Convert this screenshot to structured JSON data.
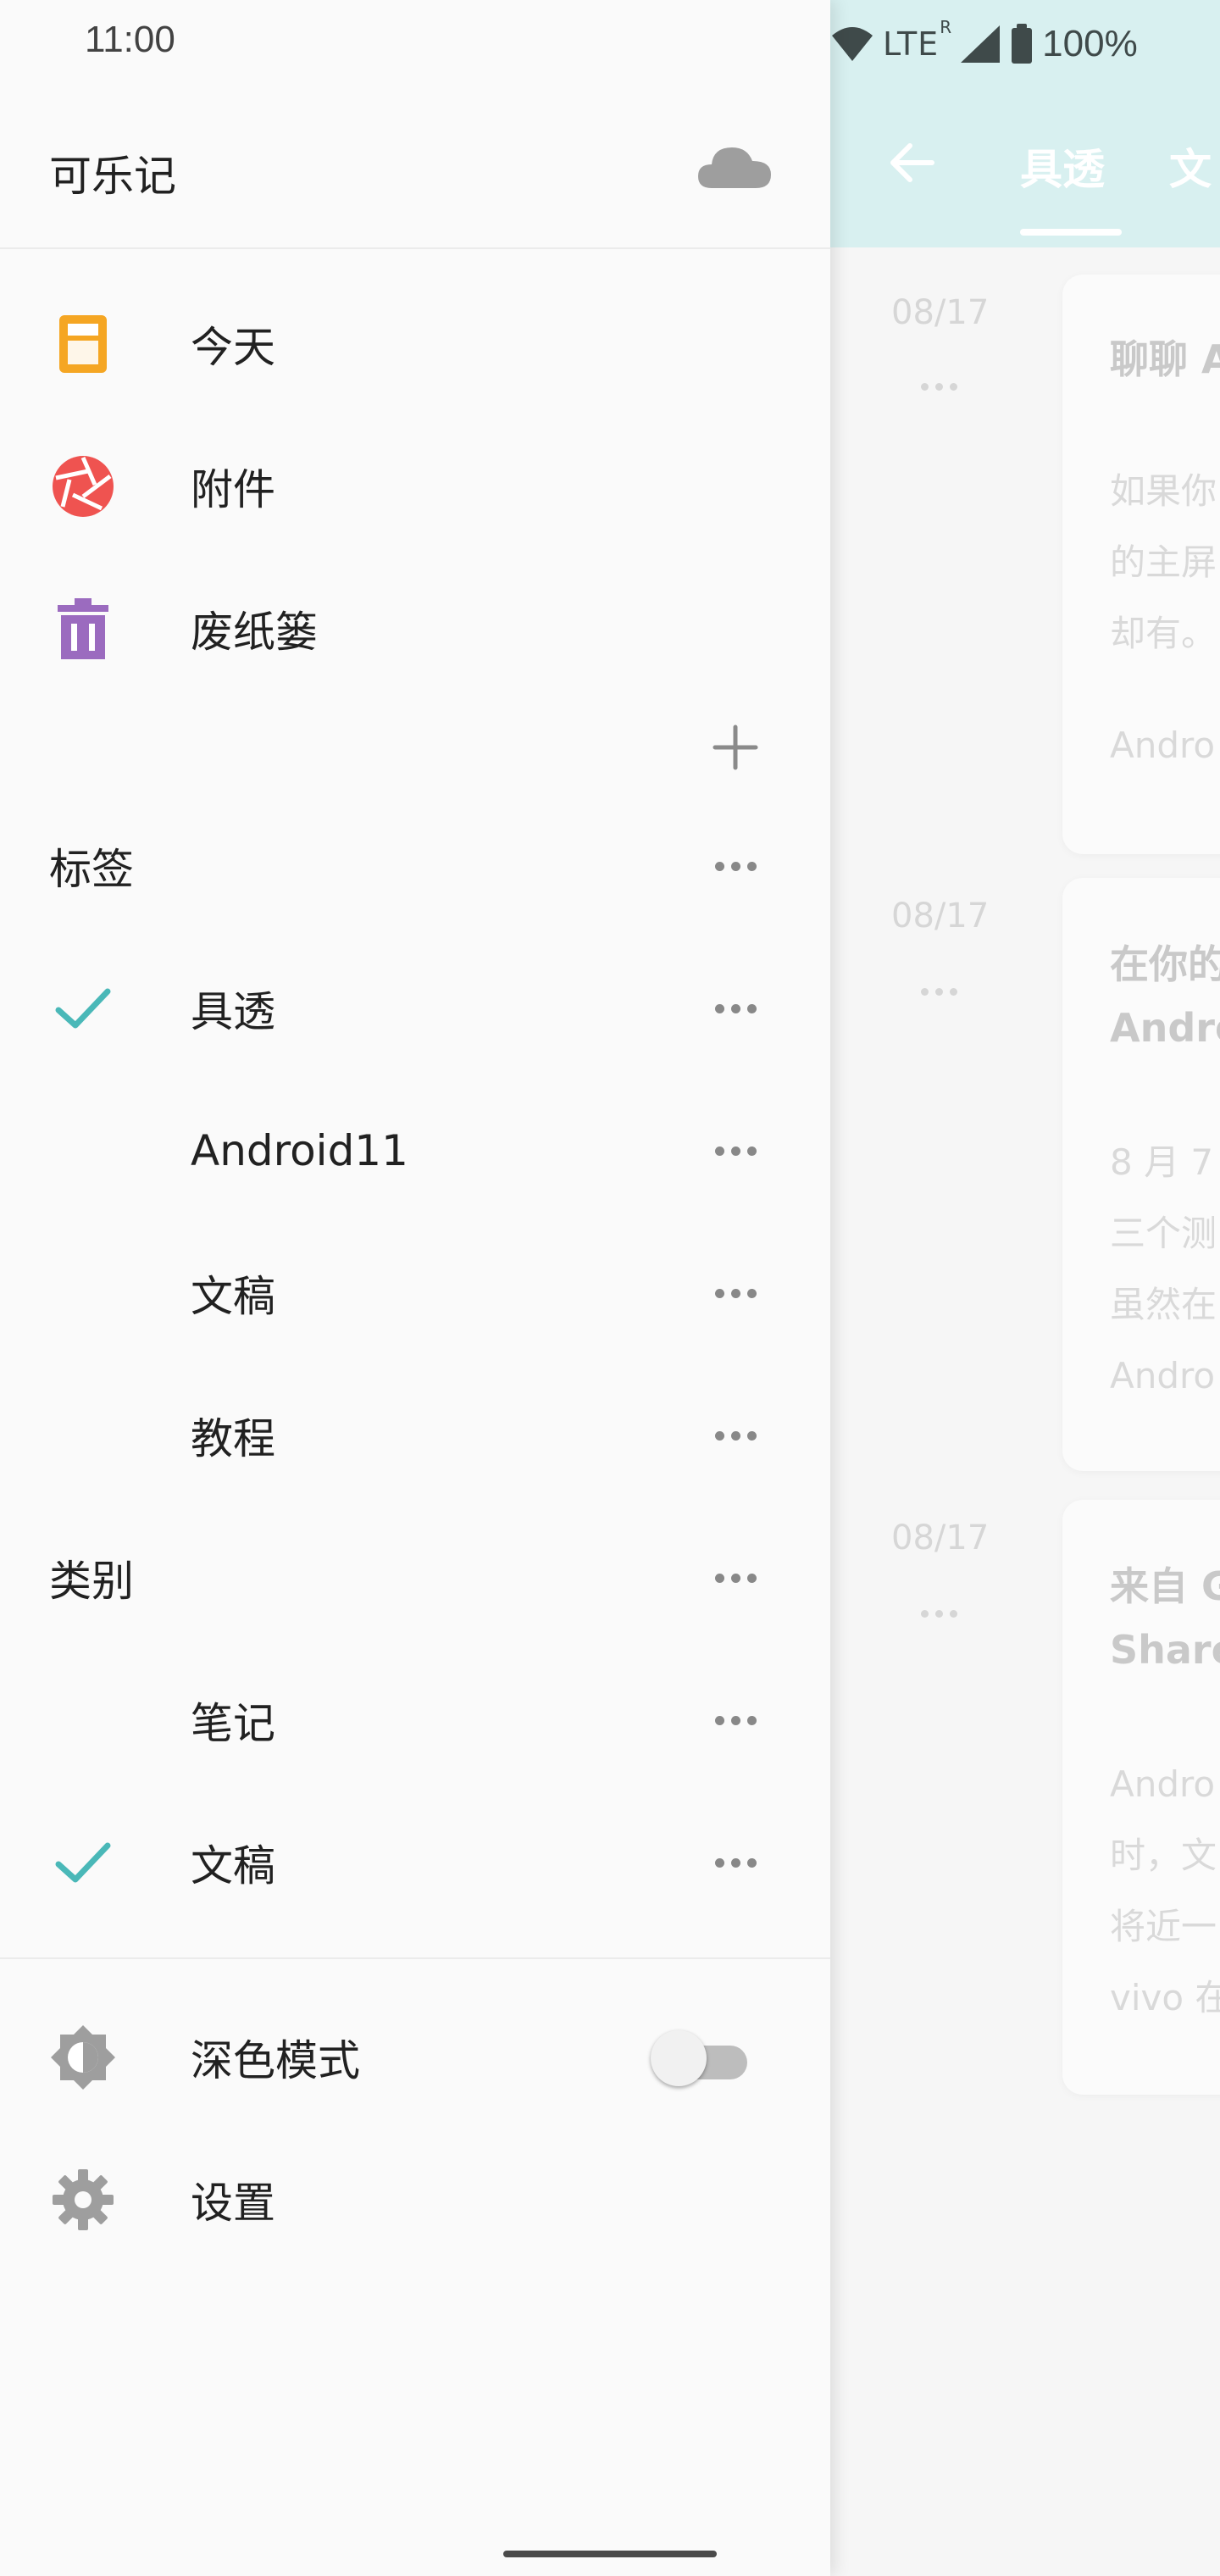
{
  "status_bar": {
    "time": "11:00",
    "network": "LTE",
    "roaming": "R",
    "battery": "100%"
  },
  "background": {
    "tabs": [
      "具透",
      "文"
    ],
    "entries": [
      {
        "date": "08/17",
        "title_lines": [
          "聊聊 A"
        ],
        "body_lines": [
          "如果你",
          "的主屏",
          "却有。"
        ],
        "tag": "Andro"
      },
      {
        "date": "08/17",
        "title_lines": [
          "在你的",
          "Andro"
        ],
        "body_lines": [
          "8 月 7",
          "三个测",
          "虽然在"
        ],
        "tag": "Andro"
      },
      {
        "date": "08/17",
        "title_lines": [
          "来自 G",
          "Share"
        ],
        "body_lines": [
          "Andro",
          "时，文",
          "将近一",
          "vivo 在"
        ],
        "tag": ""
      }
    ]
  },
  "drawer": {
    "app_name": "可乐记",
    "nav": [
      {
        "label": "今天",
        "icon": "today-icon"
      },
      {
        "label": "附件",
        "icon": "attachment-aperture-icon"
      },
      {
        "label": "废纸篓",
        "icon": "trash-icon"
      }
    ],
    "tags_section": {
      "title": "标签",
      "items": [
        {
          "label": "具透",
          "checked": true
        },
        {
          "label": "Android11",
          "checked": false
        },
        {
          "label": "文稿",
          "checked": false
        },
        {
          "label": "教程",
          "checked": false
        }
      ]
    },
    "categories_section": {
      "title": "类别",
      "items": [
        {
          "label": "笔记",
          "checked": false
        },
        {
          "label": "文稿",
          "checked": true
        }
      ]
    },
    "bottom": [
      {
        "label": "深色模式",
        "icon": "brightness-icon",
        "toggle": false
      },
      {
        "label": "设置",
        "icon": "gear-icon"
      }
    ]
  },
  "colors": {
    "accent_teal": "#4ab8b8",
    "today_orange": "#f5a623",
    "attachment_red": "#ef5350",
    "trash_purple": "#9b6bbf",
    "header_bg": "#d8f0f0"
  }
}
